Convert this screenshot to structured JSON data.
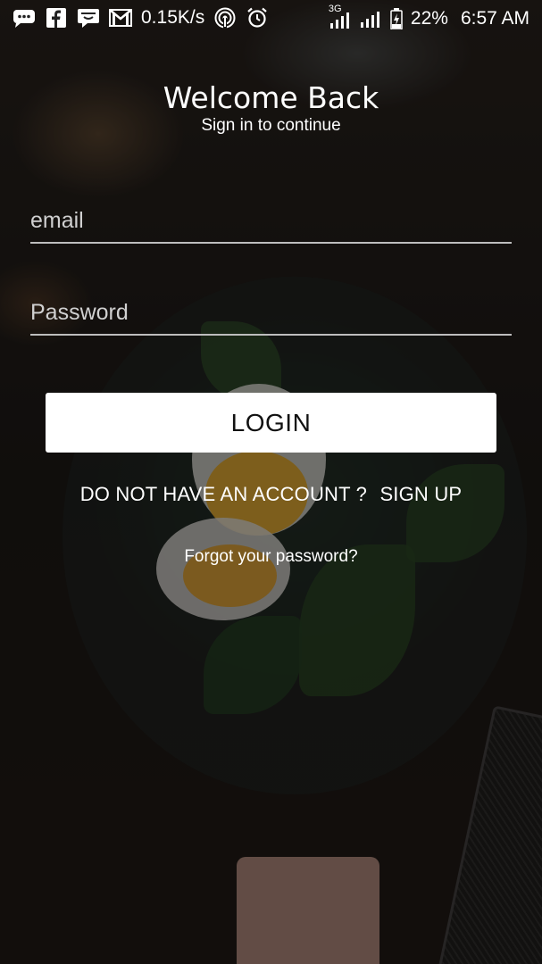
{
  "status_bar": {
    "net_speed": "0.15K/s",
    "network_type": "3G",
    "battery": "22%",
    "time": "6:57 AM",
    "icons": [
      "message-icon",
      "facebook-icon",
      "chat-icon",
      "gmail-icon",
      "hotspot-icon",
      "alarm-icon",
      "signal-icon",
      "signal-icon",
      "battery-charging-icon"
    ]
  },
  "header": {
    "title": "Welcome Back",
    "subtitle": "Sign in to continue"
  },
  "form": {
    "email_placeholder": "email",
    "email_value": "",
    "password_placeholder": "Password",
    "password_value": ""
  },
  "buttons": {
    "login_label": "LOGIN",
    "no_account_text": "DO NOT HAVE AN ACCOUNT ?",
    "signup_label": "SIGN UP",
    "forgot_label": "Forgot your password?"
  },
  "colors": {
    "button_bg": "#ffffff",
    "text": "#ffffff"
  }
}
